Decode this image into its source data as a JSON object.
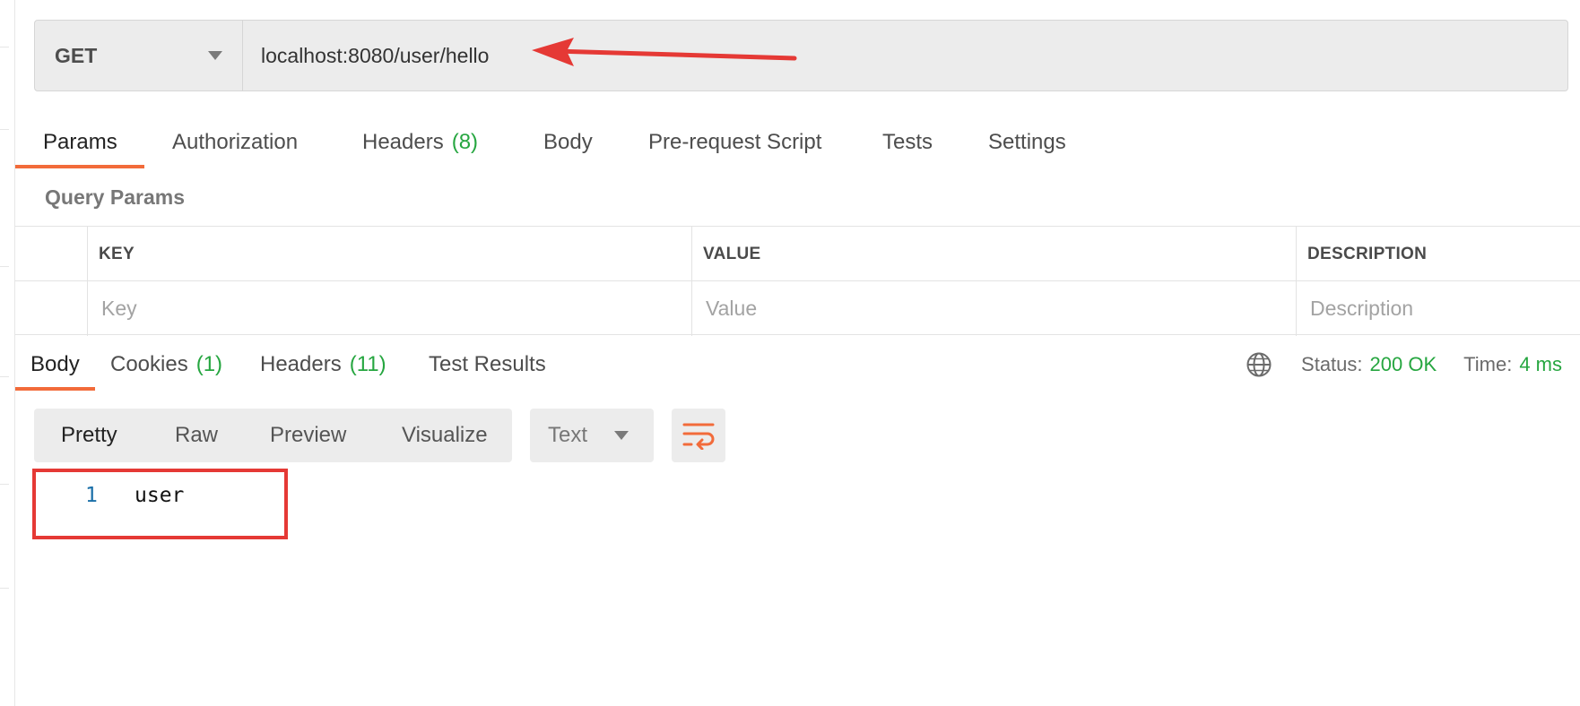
{
  "request": {
    "method": "GET",
    "url": "localhost:8080/user/hello"
  },
  "request_tabs": [
    {
      "label": "Params",
      "count": ""
    },
    {
      "label": "Authorization",
      "count": ""
    },
    {
      "label": "Headers",
      "count": "(8)"
    },
    {
      "label": "Body",
      "count": ""
    },
    {
      "label": "Pre-request Script",
      "count": ""
    },
    {
      "label": "Tests",
      "count": ""
    },
    {
      "label": "Settings",
      "count": ""
    }
  ],
  "query_params": {
    "title": "Query Params",
    "headers": [
      "KEY",
      "VALUE",
      "DESCRIPTION"
    ],
    "placeholders": {
      "key": "Key",
      "value": "Value",
      "description": "Description"
    }
  },
  "response_tabs": [
    {
      "label": "Body",
      "count": ""
    },
    {
      "label": "Cookies",
      "count": "(1)"
    },
    {
      "label": "Headers",
      "count": "(11)"
    },
    {
      "label": "Test Results",
      "count": ""
    }
  ],
  "status": {
    "status_label": "Status:",
    "status_value": "200 OK",
    "time_label": "Time:",
    "time_value": "4 ms"
  },
  "format_buttons": [
    "Pretty",
    "Raw",
    "Preview",
    "Visualize"
  ],
  "response_type": "Text",
  "response_body": [
    {
      "line": "1",
      "text": "user"
    }
  ],
  "colors": {
    "accent": "#f26b3a",
    "success": "#26a640",
    "annotation": "#e53935"
  },
  "icons": {
    "method_dropdown": "chevron-down-icon",
    "network": "globe-icon",
    "wrap": "wrap-lines-icon"
  }
}
